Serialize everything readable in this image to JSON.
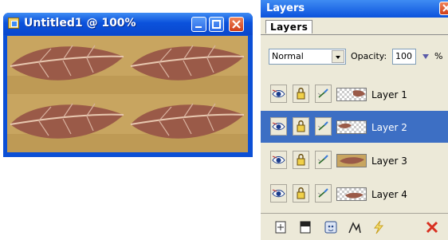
{
  "image_window": {
    "title": "Untitled1 @ 100%",
    "buttons": [
      "minimize",
      "maximize",
      "close"
    ]
  },
  "layers_palette": {
    "title": "Layers",
    "tab": "Layers",
    "blend_mode": "Normal",
    "opacity_label": "Opacity:",
    "opacity_value": "100",
    "opacity_unit": "%",
    "layers": [
      {
        "name": "Layer 1",
        "selected": false,
        "thumb": "leaf-top-right"
      },
      {
        "name": "Layer 2",
        "selected": true,
        "thumb": "leaf-top-left"
      },
      {
        "name": "Layer 3",
        "selected": false,
        "thumb": "leaf-full"
      },
      {
        "name": "Layer 4",
        "selected": false,
        "thumb": "leaf-bottom"
      }
    ],
    "row_icons": [
      "eye-icon",
      "lock-icon",
      "link-brush-icon"
    ],
    "bottom_toolbar": [
      "new-layer-icon",
      "new-fill-layer-icon",
      "new-adjustment-layer-icon",
      "new-vector-layer-icon",
      "layer-effects-icon",
      "delete-layer-icon"
    ]
  },
  "colors": {
    "titlebar": "#0b52dc",
    "selection": "#3d6fc4",
    "palette_bg": "#ece9d8",
    "delete_red": "#d83020"
  }
}
